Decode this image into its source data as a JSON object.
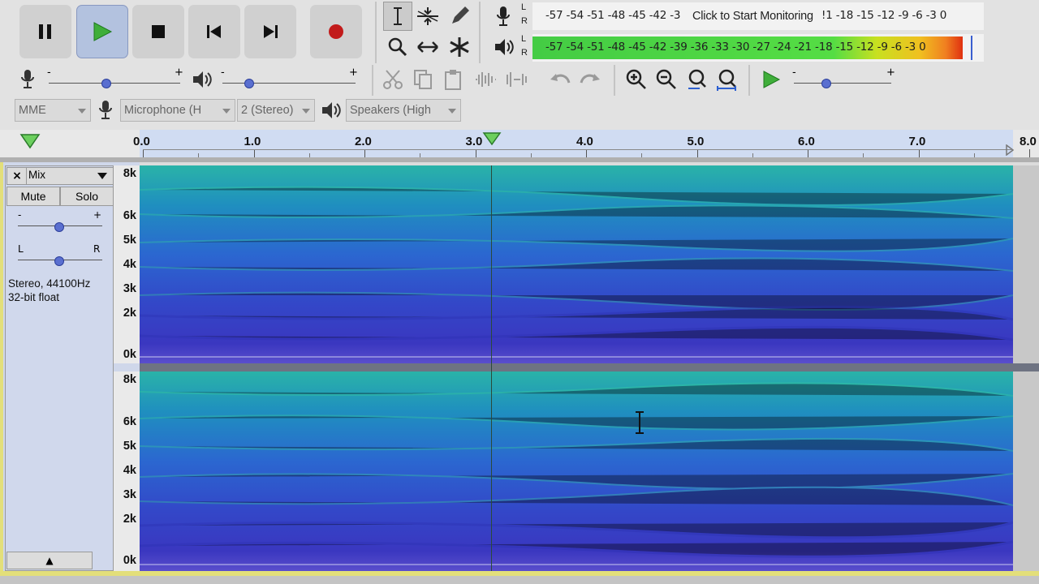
{
  "transport": {
    "pause": "pause-button",
    "play": "play-button",
    "stop": "stop-button",
    "skip_start": "skip-to-start-button",
    "skip_end": "skip-to-end-button",
    "record": "record-button"
  },
  "meters": {
    "record_scale": "-57 -54 -51 -48 -45 -42 -3",
    "record_prompt": "Click to Start Monitoring",
    "record_scale_right": "!1 -18 -15 -12  -9   -6   -3   0",
    "playback_scale": "-57 -54 -51 -48 -45 -42 -39 -36 -33 -30 -27 -24 -21 -18 -15 -12  -9   -6   -3   0",
    "L": "L",
    "R": "R"
  },
  "mixer": {
    "minus": "-",
    "plus": "+"
  },
  "devices": {
    "host": "MME",
    "input": "Microphone (H",
    "channels": "2 (Stereo)",
    "output": "Speakers (High"
  },
  "ruler": {
    "ticks": [
      "0.0",
      "1.0",
      "2.0",
      "3.0",
      "4.0",
      "5.0",
      "6.0",
      "7.0",
      "8.0"
    ]
  },
  "track": {
    "name": "Mix",
    "close": "×",
    "mute": "Mute",
    "solo": "Solo",
    "gain_minus": "-",
    "gain_plus": "+",
    "pan_left": "L",
    "pan_right": "R",
    "info_line1": "Stereo, 44100Hz",
    "info_line2": "32-bit float",
    "collapse": "▲"
  },
  "freq_labels_top": [
    "8k",
    "6k",
    "5k",
    "4k",
    "3k",
    "2k",
    "0k"
  ],
  "freq_labels_bottom": [
    "8k",
    "6k",
    "5k",
    "4k",
    "3k",
    "2k",
    "0k"
  ]
}
